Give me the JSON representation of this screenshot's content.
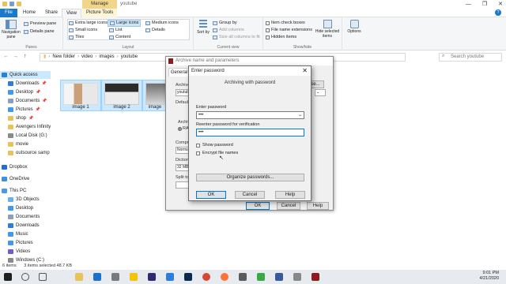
{
  "window": {
    "manage_tab": "Manage",
    "title": "youtube",
    "min": "—",
    "max": "❐",
    "close": "✕"
  },
  "tabs": {
    "file": "File",
    "home": "Home",
    "share": "Share",
    "view": "View",
    "picture_tools": "Picture Tools",
    "help": "?"
  },
  "ribbon": {
    "panes": {
      "label": "Panes",
      "navigation_pane": "Navigation pane",
      "preview_pane": "Preview pane",
      "details_pane": "Details pane"
    },
    "layout": {
      "label": "Layout",
      "items": [
        "Extra large icons",
        "Large icons",
        "Medium icons",
        "Small icons",
        "List",
        "Details",
        "Tiles",
        "Content"
      ],
      "selected": "Large icons"
    },
    "current_view": {
      "label": "Current view",
      "sort_by": "Sort by",
      "group_by": "Group by",
      "add_columns": "Add columns",
      "size_all_columns": "Size all columns to fit"
    },
    "show_hide": {
      "label": "Show/hide",
      "item_check_boxes": "Item check boxes",
      "file_name_extensions": "File name extensions",
      "hidden_items": "Hidden items",
      "hide_selected": "Hide selected items",
      "options": "Options"
    }
  },
  "address": {
    "path": [
      "New folder",
      "video",
      "images",
      "youtube"
    ],
    "search_placeholder": "Search youtube",
    "back": "←",
    "forward": "→",
    "up": "↑"
  },
  "navpane": {
    "items": [
      {
        "label": "Quick access",
        "color": "#2b7fd8",
        "pinned": false
      },
      {
        "label": "Downloads",
        "color": "#2b7fd8",
        "pinned": true
      },
      {
        "label": "Desktop",
        "color": "#3d9be9",
        "pinned": true
      },
      {
        "label": "Documents",
        "color": "#8aa0b8",
        "pinned": true
      },
      {
        "label": "Pictures",
        "color": "#3d9be9",
        "pinned": true
      },
      {
        "label": "shop",
        "color": "#e8c35a",
        "pinned": true
      },
      {
        "label": "Avengers Infinity",
        "color": "#e8c35a",
        "pinned": false
      },
      {
        "label": "Local Disk (G:)",
        "color": "#8a8a8a",
        "pinned": false
      },
      {
        "label": "movie",
        "color": "#e8c35a",
        "pinned": false
      },
      {
        "label": "outsource samp",
        "color": "#e8c35a",
        "pinned": false
      },
      {
        "label": "Dropbox",
        "color": "#1f6fd6",
        "pinned": false
      },
      {
        "label": "OneDrive",
        "color": "#3d8fe0",
        "pinned": false
      },
      {
        "label": "This PC",
        "color": "#4b9ae3",
        "pinned": false
      },
      {
        "label": "3D Objects",
        "color": "#6ab0e8",
        "pinned": false
      },
      {
        "label": "Desktop",
        "color": "#3d9be9",
        "pinned": false
      },
      {
        "label": "Documents",
        "color": "#8aa0b8",
        "pinned": false
      },
      {
        "label": "Downloads",
        "color": "#2b7fd8",
        "pinned": false
      },
      {
        "label": "Music",
        "color": "#3d9be9",
        "pinned": false
      },
      {
        "label": "Pictures",
        "color": "#3d9be9",
        "pinned": false
      },
      {
        "label": "Videos",
        "color": "#6d5fc6",
        "pinned": false
      },
      {
        "label": "Windows (C:)",
        "color": "#8a8a8a",
        "pinned": false
      }
    ]
  },
  "files": [
    {
      "name": "image 1"
    },
    {
      "name": "image 2"
    },
    {
      "name": "image"
    }
  ],
  "status": {
    "count": "6 items",
    "selection": "3 items selected  48.7 KB"
  },
  "archive_dialog": {
    "title": "Archive name and parameters",
    "tab_general": "General",
    "archive_label": "Archive",
    "archive_value": "youtub",
    "browse": "se...",
    "default_label": "Default",
    "archive_format_label": "Archiv",
    "format_rar": "RA",
    "compression_label": "Compre",
    "compression_value": "Norma",
    "dictionary_label": "Dictiona",
    "dictionary_value": "32 MB",
    "split_label": "Split to",
    "ok": "OK",
    "cancel": "Cancel",
    "help": "Help"
  },
  "password_dialog": {
    "title": "Enter password",
    "close": "✕",
    "subtitle": "Archiving with password",
    "enter_label": "Enter password",
    "enter_value": "•••",
    "reenter_label": "Reenter password for verification",
    "reenter_value": "•••",
    "show_password": "Show password",
    "encrypt_names": "Encrypt file names",
    "organize": "Organize passwords...",
    "ok": "OK",
    "cancel": "Cancel",
    "help": "Help"
  },
  "taskbar": {
    "time": "9:01 PM",
    "date": "4/21/2020"
  },
  "colors": {
    "accent": "#1979ca",
    "selection": "#cce8ff",
    "manage": "#f0d58a"
  }
}
